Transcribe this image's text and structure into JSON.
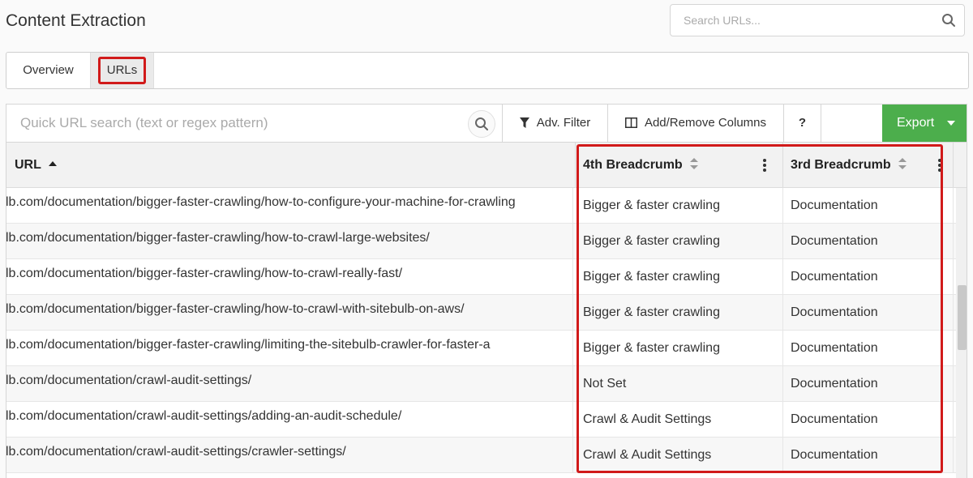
{
  "header": {
    "title": "Content Extraction",
    "search_placeholder": "Search URLs..."
  },
  "tabs": [
    {
      "label": "Overview",
      "active": false
    },
    {
      "label": "URLs",
      "active": true
    }
  ],
  "toolbar": {
    "quick_search_placeholder": "Quick URL search (text or regex pattern)",
    "filter_label": "Adv. Filter",
    "columns_label": "Add/Remove Columns",
    "help_label": "?",
    "export_label": "Export"
  },
  "table": {
    "columns": [
      {
        "label": "URL",
        "sort": "asc"
      },
      {
        "label": "4th Breadcrumb",
        "sort": "none"
      },
      {
        "label": "3rd Breadcrumb",
        "sort": "none"
      }
    ],
    "rows": [
      {
        "url": "lb.com/documentation/bigger-faster-crawling/how-to-configure-your-machine-for-crawling",
        "b4": "Bigger & faster crawling",
        "b3": "Documentation"
      },
      {
        "url": "lb.com/documentation/bigger-faster-crawling/how-to-crawl-large-websites/",
        "b4": "Bigger & faster crawling",
        "b3": "Documentation"
      },
      {
        "url": "lb.com/documentation/bigger-faster-crawling/how-to-crawl-really-fast/",
        "b4": "Bigger & faster crawling",
        "b3": "Documentation"
      },
      {
        "url": "lb.com/documentation/bigger-faster-crawling/how-to-crawl-with-sitebulb-on-aws/",
        "b4": "Bigger & faster crawling",
        "b3": "Documentation"
      },
      {
        "url": "lb.com/documentation/bigger-faster-crawling/limiting-the-sitebulb-crawler-for-faster-a",
        "b4": "Bigger & faster crawling",
        "b3": "Documentation"
      },
      {
        "url": "lb.com/documentation/crawl-audit-settings/",
        "b4": "Not Set",
        "b3": "Documentation"
      },
      {
        "url": "lb.com/documentation/crawl-audit-settings/adding-an-audit-schedule/",
        "b4": "Crawl & Audit Settings",
        "b3": "Documentation"
      },
      {
        "url": "lb.com/documentation/crawl-audit-settings/crawler-settings/",
        "b4": "Crawl & Audit Settings",
        "b3": "Documentation"
      }
    ]
  },
  "colors": {
    "accent_export": "#4cae4c",
    "highlight": "#d11a1a"
  },
  "icons": {
    "search": "search-icon",
    "filter": "filter-icon",
    "columns": "columns-icon",
    "caret": "caret-down-icon",
    "menu": "kebab-menu-icon"
  }
}
